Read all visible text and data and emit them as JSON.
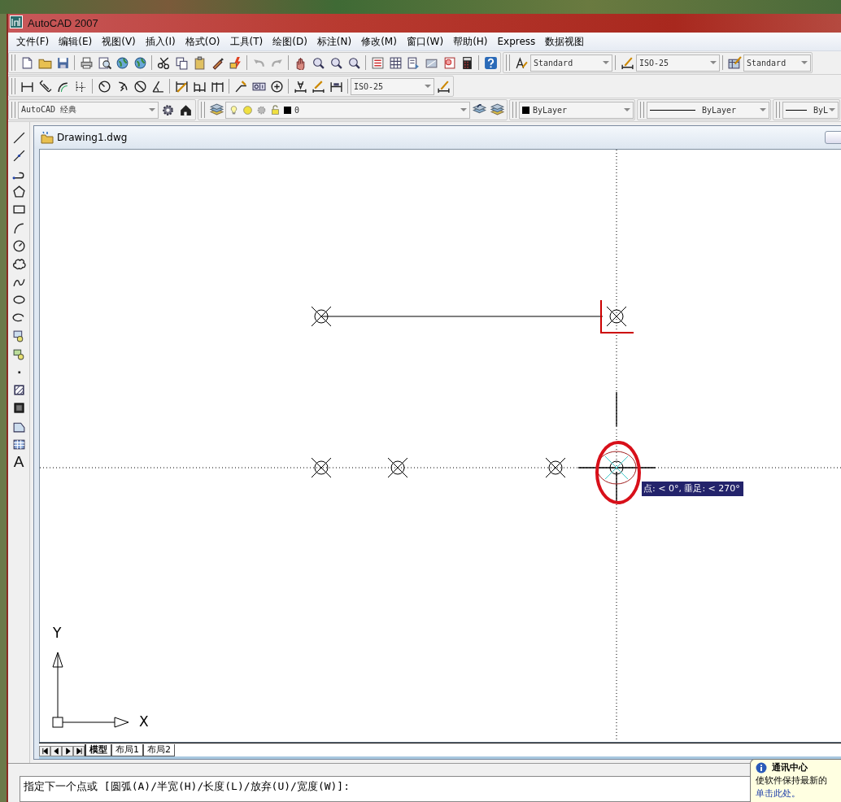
{
  "window": {
    "title": "AutoCAD 2007"
  },
  "menu": [
    "文件(F)",
    "编辑(E)",
    "视图(V)",
    "插入(I)",
    "格式(O)",
    "工具(T)",
    "绘图(D)",
    "标注(N)",
    "修改(M)",
    "窗口(W)",
    "帮助(H)",
    "Express",
    "数据视图"
  ],
  "toolbar_rows": [
    {
      "combos": [
        {
          "kind": "text",
          "value": "Standard"
        },
        {
          "kind": "text",
          "value": "ISO-25"
        },
        {
          "kind": "text",
          "value": "Standard"
        }
      ]
    },
    {
      "combos": [
        {
          "kind": "text",
          "value": "ISO-25"
        }
      ]
    },
    {
      "combos": [
        {
          "kind": "text",
          "value": "AutoCAD 经典"
        },
        {
          "kind": "layer",
          "value": "0"
        },
        {
          "kind": "color",
          "value": "ByLayer"
        },
        {
          "kind": "linetype",
          "value": "ByLayer"
        },
        {
          "kind": "linetype",
          "value": "ByL"
        }
      ]
    }
  ],
  "draw_toolbar": {
    "text_tool_label": "A"
  },
  "drawing": {
    "title": "Drawing1.dwg",
    "tooltip": "点: < 0°,  垂足: < 270°",
    "ucs": {
      "y_label": "Y",
      "x_label": "X"
    }
  },
  "layout_tabs": [
    {
      "label": "模型",
      "selected": true
    },
    {
      "label": "布局1",
      "selected": false
    },
    {
      "label": "布局2",
      "selected": false
    }
  ],
  "command_line": {
    "text": "指定下一个点或 [圆弧(A)/半宽(H)/长度(L)/放弃(U)/宽度(W)]:"
  },
  "notification": {
    "title": "通讯中心",
    "message": "使软件保持最新的",
    "link": "单击此处。"
  }
}
